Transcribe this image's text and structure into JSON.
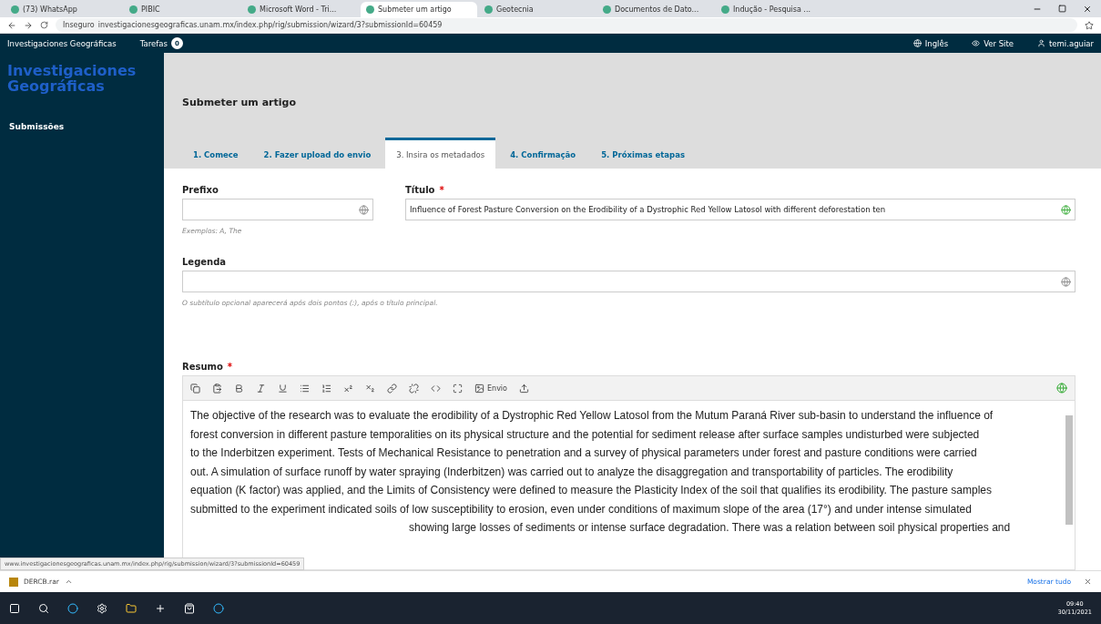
{
  "browser": {
    "tabs": [
      {
        "title": "(73) WhatsApp",
        "selected": false
      },
      {
        "title": "PIBIC",
        "selected": false
      },
      {
        "title": "Microsoft Word - Tri...",
        "selected": false
      },
      {
        "title": "Submeter um artigo",
        "selected": true
      },
      {
        "title": "Geotecnia",
        "selected": false
      },
      {
        "title": "Documentos de Dato...",
        "selected": false
      },
      {
        "title": "Indução - Pesquisa ...",
        "selected": false
      }
    ],
    "security": "Inseguro",
    "url": "investigacionesgeograficas.unam.mx/index.php/rig/submission/wizard/3?submissionId=60459"
  },
  "header": {
    "site": "Investigaciones Geográficas",
    "tasks": "Tarefas",
    "task_count": "0",
    "language": "Inglês",
    "view_site": "Ver Site",
    "user": "temi.aguiar"
  },
  "sidebar": {
    "logo": [
      "Investigaciones",
      "Geográficas"
    ],
    "items": [
      {
        "label": "Submissões",
        "selected": true
      }
    ]
  },
  "page": {
    "title": "Submeter um artigo",
    "steps": [
      {
        "label": "1. Comece",
        "selected": false
      },
      {
        "label": "2. Fazer upload do envio",
        "selected": false
      },
      {
        "label": "3. Insira os metadados",
        "selected": true
      },
      {
        "label": "4. Confirmação",
        "selected": false
      },
      {
        "label": "5. Próximas etapas",
        "selected": false
      }
    ]
  },
  "form": {
    "prefix": {
      "label": "Prefixo",
      "hint": "Exemplos: A, The"
    },
    "title": {
      "label": "Título",
      "required_mark": "*",
      "value": "Influence of Forest Pasture Conversion on the Erodibility of a Dystrophic Red Yellow Latosol with different deforestation ten"
    },
    "subtitle": {
      "label": "Legenda",
      "hint": "O subtítulo opcional aparecerá após dois pontos (:), após o título principal."
    },
    "abstract": {
      "label": "Resumo",
      "required_mark": "*",
      "image_button": "Envio",
      "lines": [
        "The objective of the research was to evaluate the erodibility of a Dystrophic Red Yellow Latosol from the Mutum Paraná River sub-basin to understand the influence of",
        "forest conversion in different pasture temporalities on its physical structure and the potential for sediment release after surface samples undisturbed were subjected",
        "to the Inderbitzen experiment. Tests of Mechanical Resistance to penetration and a survey of physical parameters under forest and pasture conditions were carried",
        "out. A simulation of surface runoff by water spraying (Inderbitzen) was carried out to analyze the disaggregation and transportability of particles. The erodibility",
        "equation (K factor) was applied, and the Limits of Consistency were defined to measure the Plasticity Index of the soil that qualifies its erodibility. The pasture samples",
        "submitted to the experiment indicated soils of low susceptibility to erosion, even under conditions of maximum slope of the area (17°) and under intense simulated"
      ],
      "partial_line": "showing large losses of sediments or intense surface degradation. There was a relation between soil physical properties and"
    }
  },
  "status_url": "www.investigacionesgeograficas.unam.mx/index.php/rig/submission/wizard/3?submissionId=60459",
  "downloads": {
    "file": "DERCB.rar",
    "show_all": "Mostrar tudo"
  },
  "taskbar": {
    "time": "09:40",
    "date": "30/11/2021"
  }
}
